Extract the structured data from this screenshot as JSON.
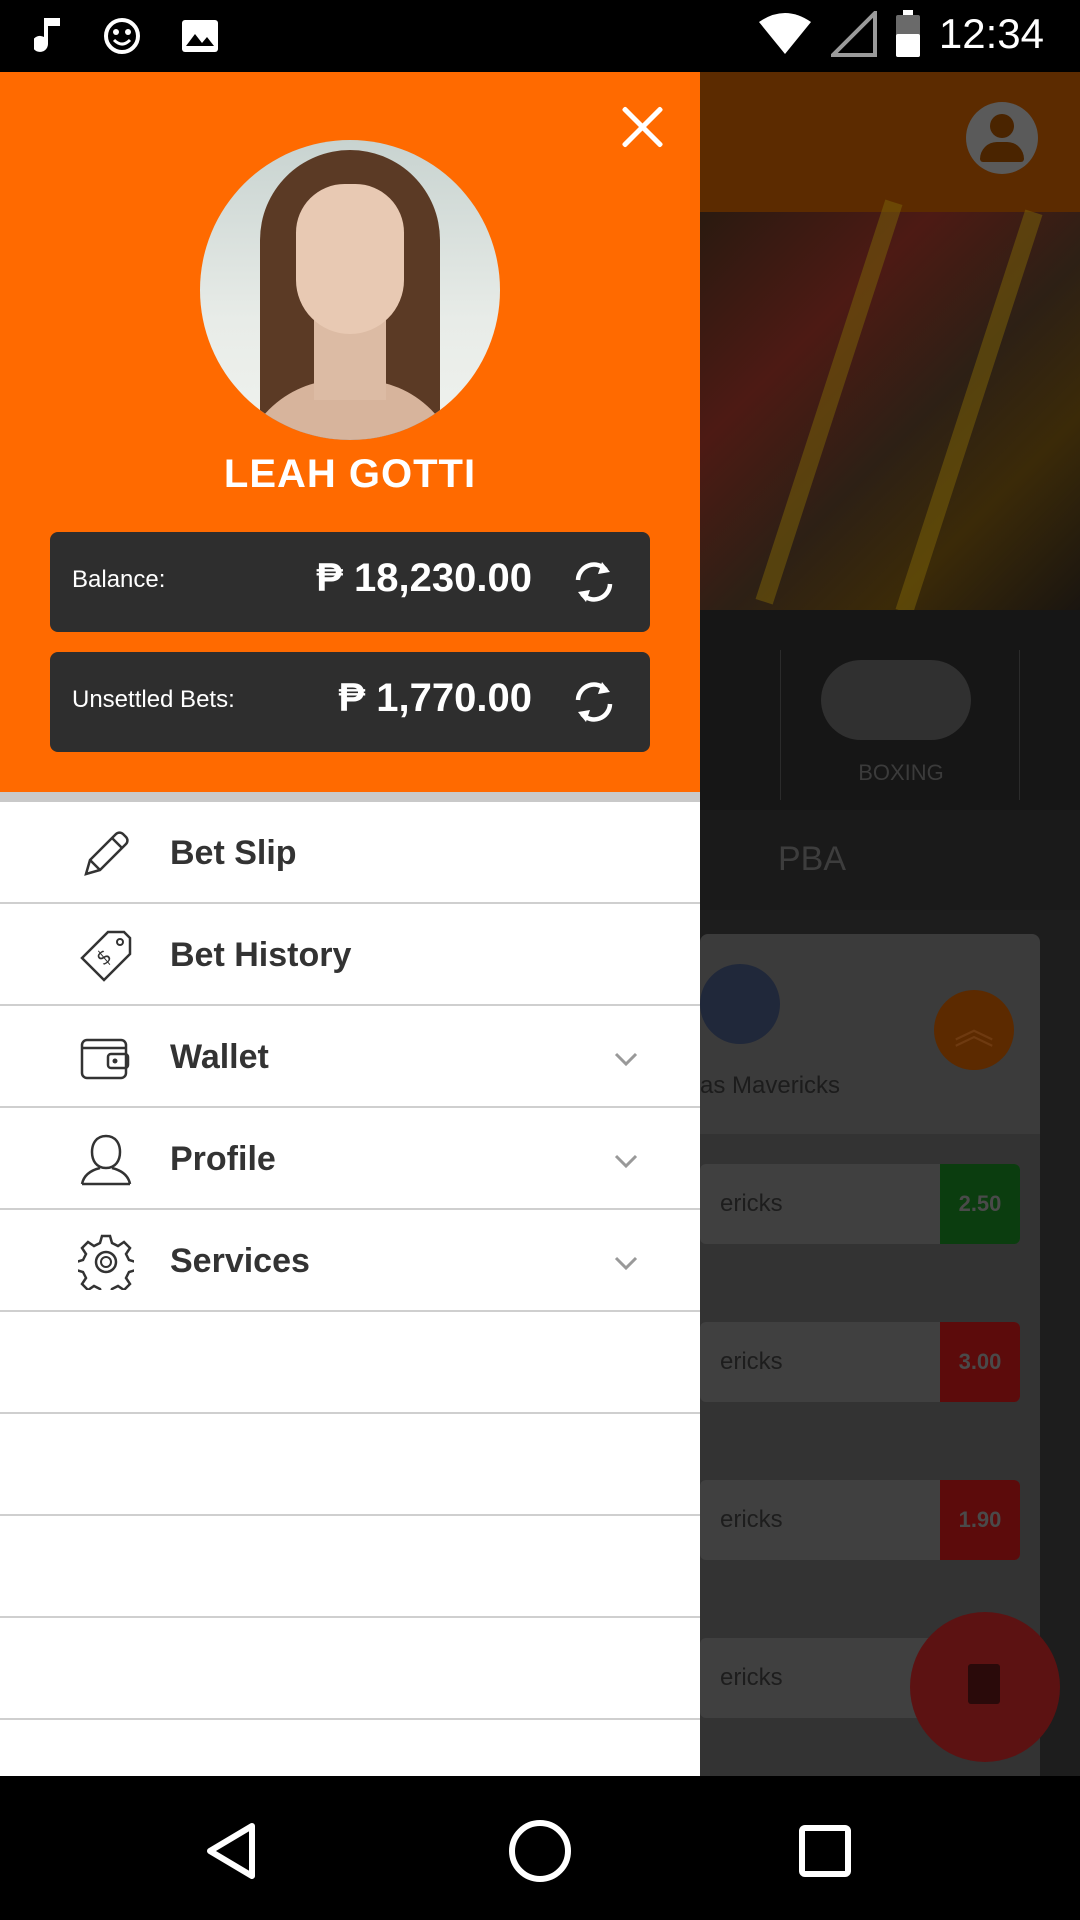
{
  "status_bar": {
    "time": "12:34",
    "left_icons": [
      "music-icon",
      "smiley-icon",
      "image-icon"
    ],
    "right_icons": [
      "wifi-icon",
      "signal-icon",
      "battery-icon"
    ]
  },
  "background": {
    "sport_label": "BOXING",
    "tab_label": "PBA",
    "team_name": "as Mavericks",
    "odds_rows": [
      {
        "team": "ericks",
        "odd": "2.50",
        "color": "#0b5d12"
      },
      {
        "team": "ericks",
        "odd": "3.00",
        "color": "#7a0b0b"
      },
      {
        "team": "ericks",
        "odd": "1.90",
        "color": "#7a0b0b"
      },
      {
        "team": "ericks",
        "odd": "",
        "color": "#404040"
      }
    ]
  },
  "drawer": {
    "accent_color": "#ff6a00",
    "user_name": "LEAH GOTTI",
    "balance": {
      "label": "Balance:",
      "amount": "₱ 18,230.00"
    },
    "unsettled": {
      "label": "Unsettled Bets:",
      "amount": "₱ 1,770.00"
    },
    "menu": [
      {
        "label": "Bet Slip",
        "icon": "pencil-icon",
        "expandable": false
      },
      {
        "label": "Bet History",
        "icon": "money-tag-icon",
        "expandable": false
      },
      {
        "label": "Wallet",
        "icon": "wallet-icon",
        "expandable": true
      },
      {
        "label": "Profile",
        "icon": "person-icon",
        "expandable": true
      },
      {
        "label": "Services",
        "icon": "gear-icon",
        "expandable": true
      }
    ]
  },
  "nav_bar": {
    "buttons": [
      "back-icon",
      "home-icon",
      "recents-icon"
    ]
  }
}
